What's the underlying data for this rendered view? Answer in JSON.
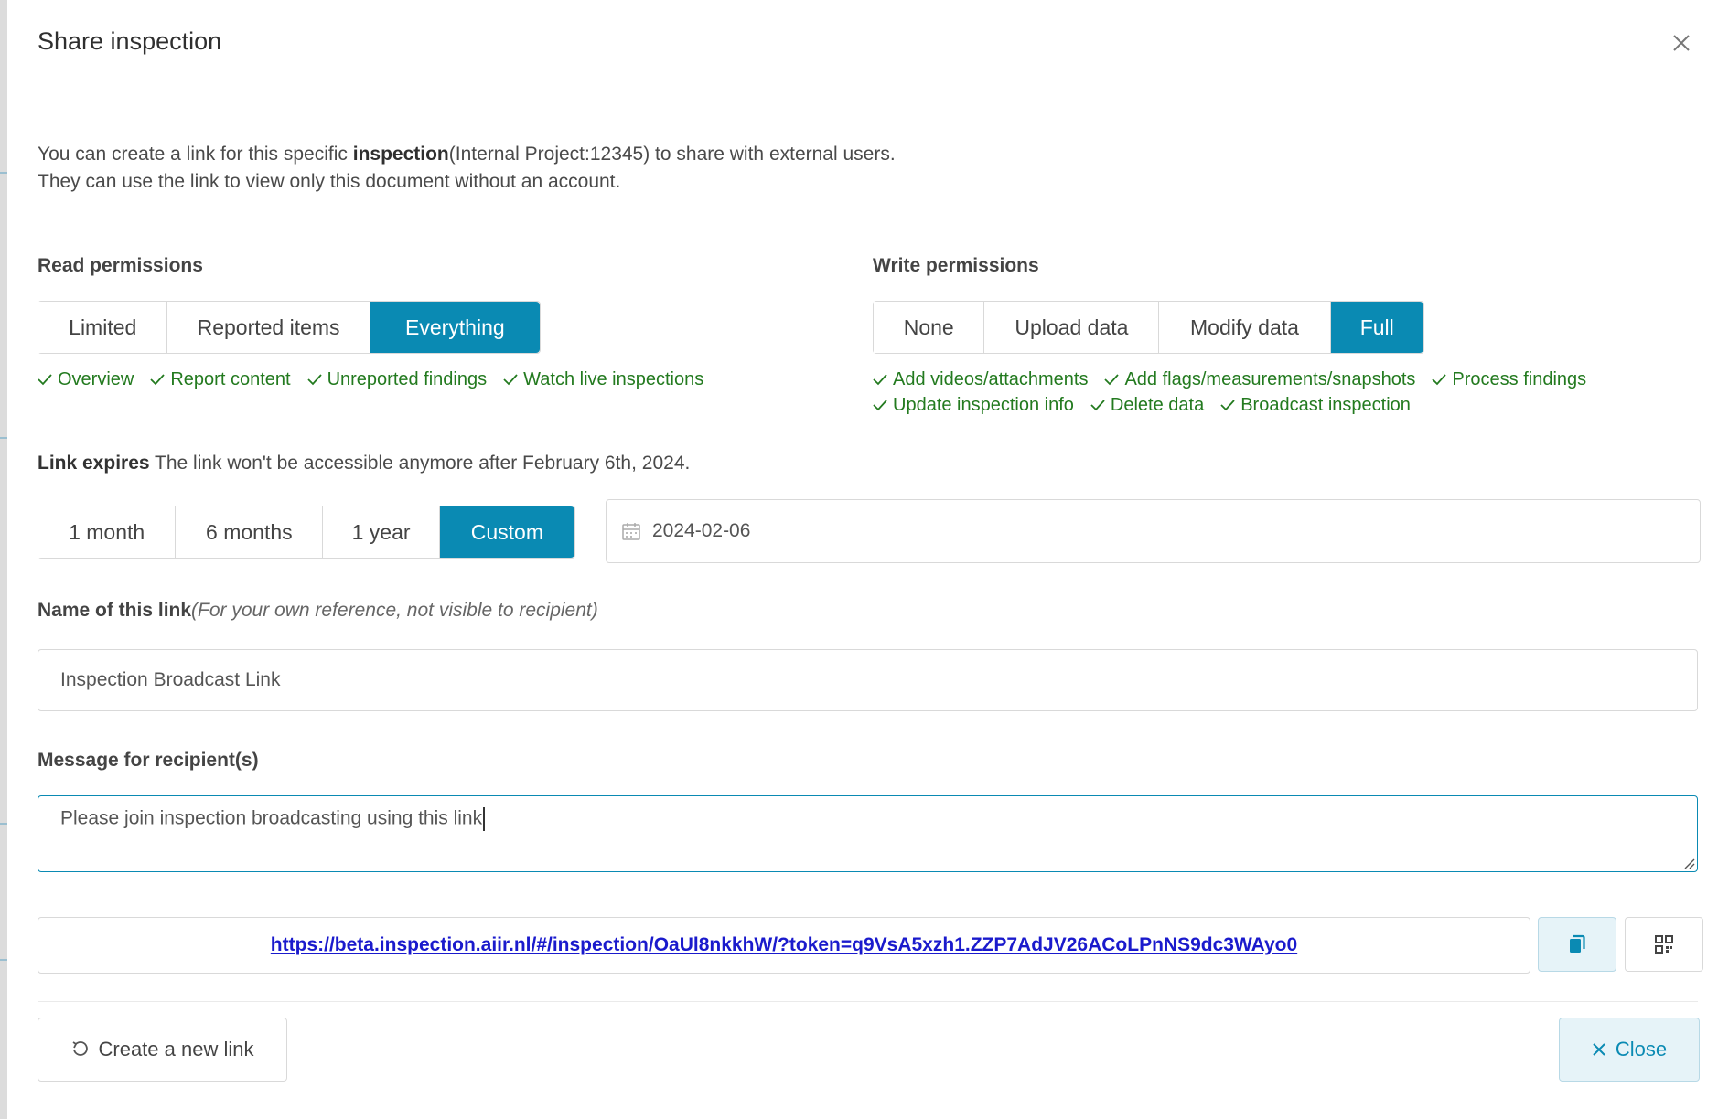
{
  "dialog": {
    "title": "Share inspection",
    "close_icon": "close-icon"
  },
  "intro": {
    "line1_prefix": "You can create a link for this specific ",
    "line1_bold": "inspection",
    "line1_suffix": "(Internal Project:12345) to share with external users.",
    "line2": "They can use the link to view only this document without an account."
  },
  "read_permissions": {
    "label": "Read permissions",
    "options": [
      "Limited",
      "Reported items",
      "Everything"
    ],
    "selected": "Everything",
    "checks": [
      "Overview",
      "Report content",
      "Unreported findings",
      "Watch live inspections"
    ]
  },
  "write_permissions": {
    "label": "Write permissions",
    "options": [
      "None",
      "Upload data",
      "Modify data",
      "Full"
    ],
    "selected": "Full",
    "checks_row1": [
      "Add videos/attachments",
      "Add flags/measurements/snapshots",
      "Process findings"
    ],
    "checks_row2": [
      "Update inspection info",
      "Delete data",
      "Broadcast inspection"
    ]
  },
  "expiry": {
    "label": "Link expires",
    "text": " The link won't be accessible anymore after February 6th, 2024.",
    "options": [
      "1 month",
      "6 months",
      "1 year",
      "Custom"
    ],
    "selected": "Custom",
    "date_value": "2024-02-06",
    "date_icon": "calendar-icon"
  },
  "link_name": {
    "label": "Name of this link",
    "hint": "(For your own reference, not visible to recipient)",
    "value": "Inspection Broadcast Link"
  },
  "message": {
    "label": "Message for recipient(s)",
    "value": "Please join inspection broadcasting using this link"
  },
  "share_link": {
    "url": "https://beta.inspection.aiir.nl/#/inspection/OaUl8nkkhW/?token=q9VsA5xzh1.ZZP7AdJV26ACoLPnNS9dc3WAyo0",
    "copy_icon": "copy-icon",
    "qr_icon": "qr-code-icon"
  },
  "footer": {
    "new_link_label": "Create a new link",
    "new_link_icon": "refresh-icon",
    "close_label": "Close",
    "close_icon": "close-icon"
  },
  "colors": {
    "accent": "#0a8ab3",
    "check_green": "#237a1f",
    "link_blue": "#1a1acc"
  }
}
